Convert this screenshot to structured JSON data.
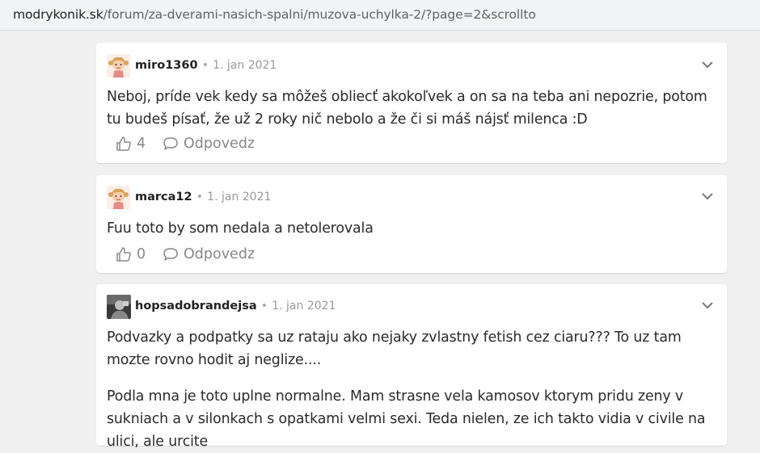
{
  "browser": {
    "url_host": "modrykonik.sk",
    "url_path": "/forum/za-dverami-nasich-spalni/muzova-uchylka-2/?page=2&scrollto"
  },
  "comments": [
    {
      "author": "miro1360",
      "separator": "•",
      "date": "1. jan 2021",
      "text": "Neboj, príde vek kedy sa môžeš obliecť akokoľvek a on sa na teba ani nepozrie, potom tu budeš písať, že už 2 roky nič nebolo a že či si máš nájsť milenca :D",
      "likes": "4",
      "reply_label": "Odpovedz"
    },
    {
      "author": "marca12",
      "separator": "•",
      "date": "1. jan 2021",
      "text": "Fuu toto by som nedala a netolerovala",
      "likes": "0",
      "reply_label": "Odpovedz"
    },
    {
      "author": "hopsadobrandejsa",
      "separator": "•",
      "date": "1. jan 2021",
      "text": "Podvazky a podpatky sa uz rataju ako nejaky zvlastny fetish cez ciaru??? To uz tam mozte rovno hodit aj neglize....",
      "text2": "Podla mna je toto uplne normalne. Mam strasne vela kamosov ktorym pridu zeny v sukniach a v silonkach s opatkami velmi sexi. Teda nielen, ze ich takto vidia v civile na ulici, ale urcite"
    }
  ],
  "colors": {
    "page_bg": "#f0f0f0",
    "card_bg": "#ffffff",
    "muted": "#888888"
  }
}
